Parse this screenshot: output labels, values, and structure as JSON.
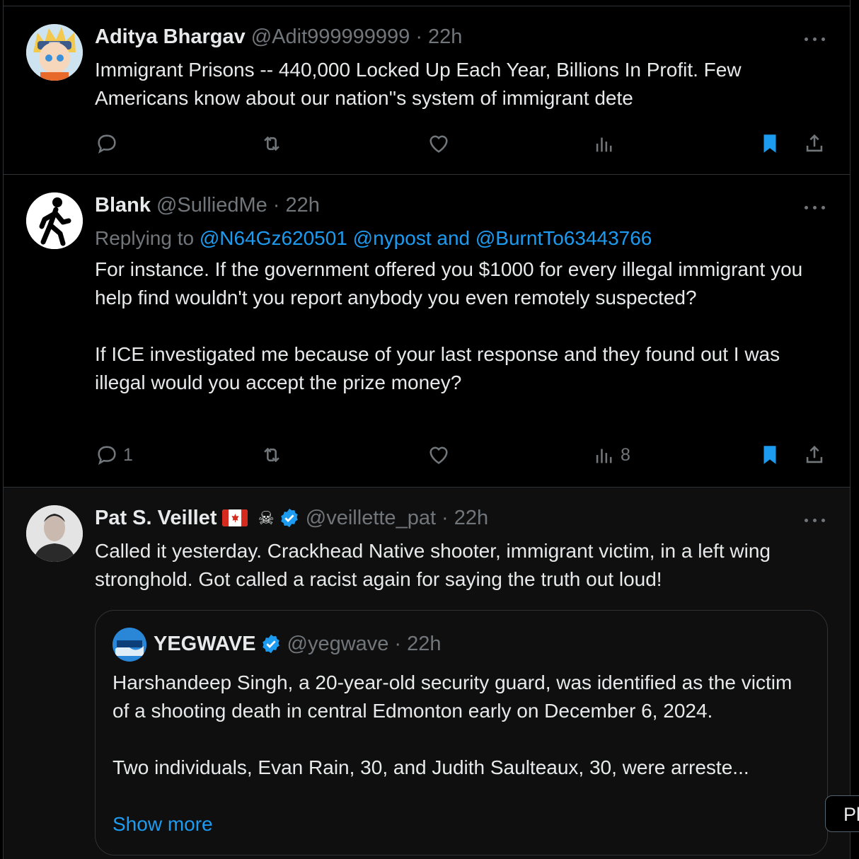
{
  "tweets": [
    {
      "name": "Aditya Bhargav",
      "handle": "@Adit999999999",
      "time": "· 22h",
      "text": "Immigrant Prisons -- 440,000 Locked Up Each Year, Billions In Profit. Few Americans know about our nation''s system of immigrant dete",
      "avatar_icon": "anime-avatar",
      "actions": {
        "replies": "",
        "views": "",
        "bookmarked": true
      }
    },
    {
      "name": "Blank",
      "handle": "@SulliedMe",
      "time": "· 22h",
      "replying_label": "Replying to",
      "reply_to_1": "@N64Gz620501",
      "reply_to_2": "@nypost",
      "reply_and": "and",
      "reply_to_3": "@BurntTo63443766",
      "text": "For instance. If the government offered you $1000 for every illegal immigrant you help find wouldn't you report anybody you even remotely suspected?\n\nIf ICE investigated me because of your last response and they found out I was illegal would you accept the prize money?",
      "avatar_icon": "walking-person-icon",
      "actions": {
        "replies": "1",
        "views": "8",
        "bookmarked": true
      }
    },
    {
      "name": "Pat S. Veillet",
      "handle": "@veillette_pat",
      "time": "· 22h",
      "skull": "☠",
      "verified": true,
      "text": "Called it yesterday.  Crackhead Native shooter, immigrant victim, in a left wing stronghold.  Got called a racist again for saying the truth out loud!",
      "avatar_icon": "portrait-photo",
      "quote": {
        "name": "YEGWAVE",
        "handle": "@yegwave",
        "time": "· 22h",
        "text": "Harshandeep Singh, a 20-year-old security guard, was identified as the victim of a shooting death in central Edmonton early on December 6, 2024.\n\nTwo individuals, Evan Rain, 30, and Judith Saulteaux, 30, were arreste...",
        "show_more": "Show more",
        "avatar_logo_text": "YEGWAVE"
      }
    }
  ],
  "floating_pill": "Pl",
  "colors": {
    "accent": "#1d9bf0",
    "muted": "#71767b",
    "text": "#e7e9ea",
    "border": "#2f3336"
  }
}
